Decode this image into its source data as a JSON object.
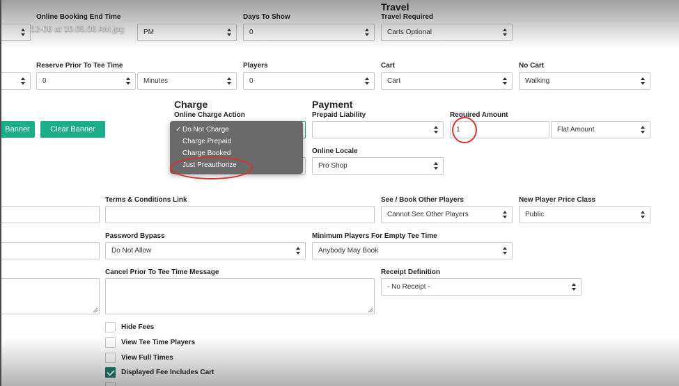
{
  "file_title": "ot 2024-12-06 at 10.05.06 AM.jpg",
  "row1": {
    "end_time_label": "Online Booking End Time",
    "end_time_ampm": "PM",
    "days_label": "Days To Show",
    "days_value": "0",
    "travel_heading": "Travel",
    "travel_label": "Travel Required",
    "travel_value": "Carts Optional"
  },
  "row2": {
    "reserve_label": "Reserve Prior To Tee Time",
    "reserve_value": "0",
    "reserve_unit": "Minutes",
    "players_label": "Players",
    "players_value": "0",
    "cart_label": "Cart",
    "cart_value": "Cart",
    "nocart_label": "No Cart",
    "nocart_value": "Walking"
  },
  "banner": {
    "set_label": "Banner",
    "clear_label": "Clear Banner"
  },
  "charge": {
    "heading": "Charge",
    "action_label": "Online Charge Action",
    "options": [
      "Do Not Charge",
      "Charge Prepaid",
      "Charge Booked",
      "Just Preauthorize"
    ],
    "selected_mark": "✓"
  },
  "payment": {
    "heading": "Payment",
    "prepaid_label": "Prepaid Liability",
    "prepaid_value": "",
    "required_label": "Required Amount",
    "required_value": "1",
    "amount_type": "Flat Amount",
    "locale_label": "Online Locale",
    "locale_value": "Pro Shop"
  },
  "row4": {
    "terms_label": "Terms & Conditions Link",
    "terms_value": "",
    "see_label": "See / Book Other Players",
    "see_value": "Cannot See Other Players",
    "price_label": "New Player Price Class",
    "price_value": "Public"
  },
  "row5": {
    "bypass_label": "Password Bypass",
    "bypass_value": "Do Not Allow",
    "min_label": "Minimum Players For Empty Tee Time",
    "min_value": "Anybody May Book"
  },
  "row6": {
    "cancel_label": "Cancel Prior To Tee Time Message",
    "cancel_value": "",
    "receipt_label": "Receipt Definition",
    "receipt_value": "- No Receipt -"
  },
  "checkboxes": [
    {
      "label": "Hide Fees",
      "checked": false
    },
    {
      "label": "View Tee Time Players",
      "checked": false
    },
    {
      "label": "View Full Times",
      "checked": false
    },
    {
      "label": "Displayed Fee Includes Cart",
      "checked": true
    }
  ],
  "colors": {
    "accent": "#1cae8b",
    "annotation": "#d9322b"
  }
}
